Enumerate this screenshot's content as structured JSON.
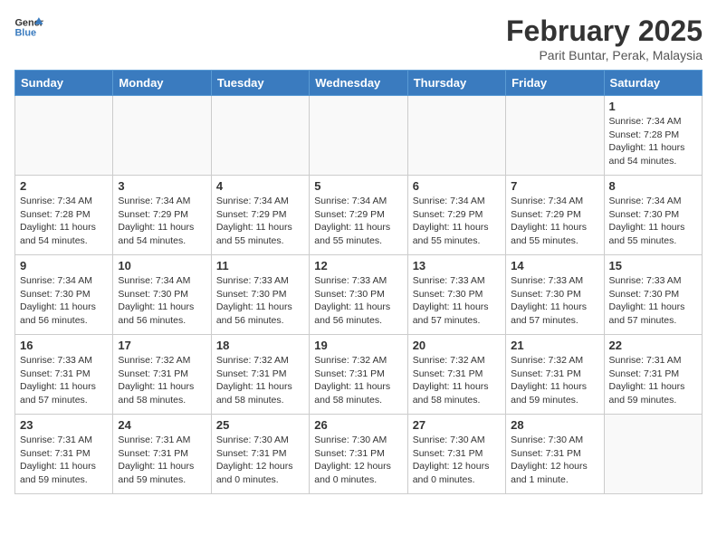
{
  "logo": {
    "line1": "General",
    "line2": "Blue"
  },
  "title": "February 2025",
  "subtitle": "Parit Buntar, Perak, Malaysia",
  "days_of_week": [
    "Sunday",
    "Monday",
    "Tuesday",
    "Wednesday",
    "Thursday",
    "Friday",
    "Saturday"
  ],
  "weeks": [
    [
      {
        "day": "",
        "info": ""
      },
      {
        "day": "",
        "info": ""
      },
      {
        "day": "",
        "info": ""
      },
      {
        "day": "",
        "info": ""
      },
      {
        "day": "",
        "info": ""
      },
      {
        "day": "",
        "info": ""
      },
      {
        "day": "1",
        "info": "Sunrise: 7:34 AM\nSunset: 7:28 PM\nDaylight: 11 hours\nand 54 minutes."
      }
    ],
    [
      {
        "day": "2",
        "info": "Sunrise: 7:34 AM\nSunset: 7:28 PM\nDaylight: 11 hours\nand 54 minutes."
      },
      {
        "day": "3",
        "info": "Sunrise: 7:34 AM\nSunset: 7:29 PM\nDaylight: 11 hours\nand 54 minutes."
      },
      {
        "day": "4",
        "info": "Sunrise: 7:34 AM\nSunset: 7:29 PM\nDaylight: 11 hours\nand 55 minutes."
      },
      {
        "day": "5",
        "info": "Sunrise: 7:34 AM\nSunset: 7:29 PM\nDaylight: 11 hours\nand 55 minutes."
      },
      {
        "day": "6",
        "info": "Sunrise: 7:34 AM\nSunset: 7:29 PM\nDaylight: 11 hours\nand 55 minutes."
      },
      {
        "day": "7",
        "info": "Sunrise: 7:34 AM\nSunset: 7:29 PM\nDaylight: 11 hours\nand 55 minutes."
      },
      {
        "day": "8",
        "info": "Sunrise: 7:34 AM\nSunset: 7:30 PM\nDaylight: 11 hours\nand 55 minutes."
      }
    ],
    [
      {
        "day": "9",
        "info": "Sunrise: 7:34 AM\nSunset: 7:30 PM\nDaylight: 11 hours\nand 56 minutes."
      },
      {
        "day": "10",
        "info": "Sunrise: 7:34 AM\nSunset: 7:30 PM\nDaylight: 11 hours\nand 56 minutes."
      },
      {
        "day": "11",
        "info": "Sunrise: 7:33 AM\nSunset: 7:30 PM\nDaylight: 11 hours\nand 56 minutes."
      },
      {
        "day": "12",
        "info": "Sunrise: 7:33 AM\nSunset: 7:30 PM\nDaylight: 11 hours\nand 56 minutes."
      },
      {
        "day": "13",
        "info": "Sunrise: 7:33 AM\nSunset: 7:30 PM\nDaylight: 11 hours\nand 57 minutes."
      },
      {
        "day": "14",
        "info": "Sunrise: 7:33 AM\nSunset: 7:30 PM\nDaylight: 11 hours\nand 57 minutes."
      },
      {
        "day": "15",
        "info": "Sunrise: 7:33 AM\nSunset: 7:30 PM\nDaylight: 11 hours\nand 57 minutes."
      }
    ],
    [
      {
        "day": "16",
        "info": "Sunrise: 7:33 AM\nSunset: 7:31 PM\nDaylight: 11 hours\nand 57 minutes."
      },
      {
        "day": "17",
        "info": "Sunrise: 7:32 AM\nSunset: 7:31 PM\nDaylight: 11 hours\nand 58 minutes."
      },
      {
        "day": "18",
        "info": "Sunrise: 7:32 AM\nSunset: 7:31 PM\nDaylight: 11 hours\nand 58 minutes."
      },
      {
        "day": "19",
        "info": "Sunrise: 7:32 AM\nSunset: 7:31 PM\nDaylight: 11 hours\nand 58 minutes."
      },
      {
        "day": "20",
        "info": "Sunrise: 7:32 AM\nSunset: 7:31 PM\nDaylight: 11 hours\nand 58 minutes."
      },
      {
        "day": "21",
        "info": "Sunrise: 7:32 AM\nSunset: 7:31 PM\nDaylight: 11 hours\nand 59 minutes."
      },
      {
        "day": "22",
        "info": "Sunrise: 7:31 AM\nSunset: 7:31 PM\nDaylight: 11 hours\nand 59 minutes."
      }
    ],
    [
      {
        "day": "23",
        "info": "Sunrise: 7:31 AM\nSunset: 7:31 PM\nDaylight: 11 hours\nand 59 minutes."
      },
      {
        "day": "24",
        "info": "Sunrise: 7:31 AM\nSunset: 7:31 PM\nDaylight: 11 hours\nand 59 minutes."
      },
      {
        "day": "25",
        "info": "Sunrise: 7:30 AM\nSunset: 7:31 PM\nDaylight: 12 hours\nand 0 minutes."
      },
      {
        "day": "26",
        "info": "Sunrise: 7:30 AM\nSunset: 7:31 PM\nDaylight: 12 hours\nand 0 minutes."
      },
      {
        "day": "27",
        "info": "Sunrise: 7:30 AM\nSunset: 7:31 PM\nDaylight: 12 hours\nand 0 minutes."
      },
      {
        "day": "28",
        "info": "Sunrise: 7:30 AM\nSunset: 7:31 PM\nDaylight: 12 hours\nand 1 minute."
      },
      {
        "day": "",
        "info": ""
      }
    ]
  ]
}
